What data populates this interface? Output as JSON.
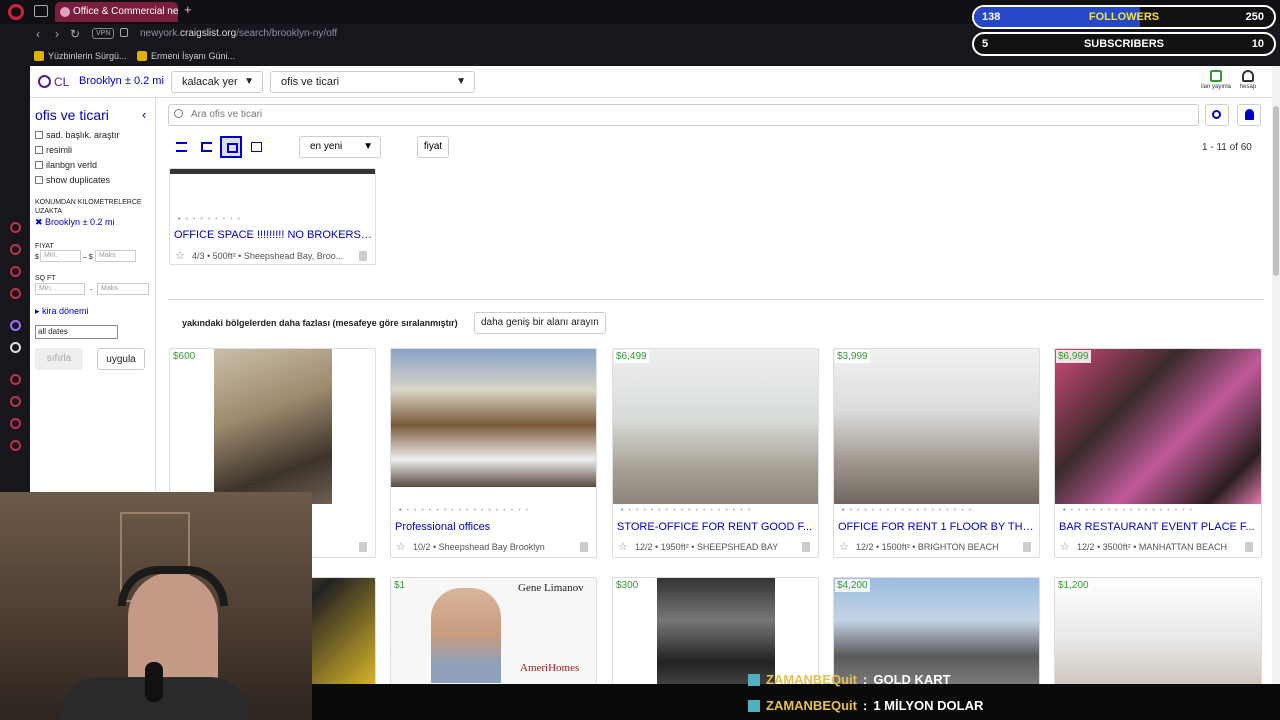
{
  "browser": {
    "tab_title": "Office & Commercial near",
    "url_prefix": "newyork.",
    "url_host": "craigslist.org",
    "url_path": "/search/brooklyn-ny/off",
    "vpn_label": "VPN",
    "bookmarks": [
      "Yüzbinlerin Sürgü...",
      "Ermeni İsyanı Güni..."
    ]
  },
  "header": {
    "logo": "CL",
    "location": "Brooklyn ± 0.2 mi",
    "area_select": "kalacak yer",
    "category_select": "ofis ve ticari",
    "post_label": "ilan yayınla",
    "account_label": "hesap"
  },
  "filters": {
    "title": "ofis ve ticari",
    "checkboxes": [
      "sad. başlık. araştır",
      "resimli",
      "ilanbgn verld",
      "show duplicates"
    ],
    "distance_label": "KONUMDAN KILOMETRELERCE UZAKTA",
    "distance_value": "Brooklyn ± 0.2 mi",
    "price_label": "FIYAT",
    "price_currency": "$",
    "price_dash": "– $",
    "price_min": "Min.",
    "price_max": "Maks",
    "sqft_label": "SQ FT",
    "sqft_min": "Min.",
    "sqft_dash": "-",
    "sqft_max": "Maks",
    "rent_period": "kira dönemi",
    "dates": "all dates",
    "reset": "sıfırla",
    "apply": "uygula"
  },
  "search": {
    "placeholder": "Ara ofis ve ticari"
  },
  "toolbar": {
    "sort": "en yeni",
    "price": "fiyat",
    "count": "1 - 11 of 60"
  },
  "listings": [
    {
      "title": "OFFICE SPACE !!!!!!!!! NO BROKERS F...",
      "meta": "4/3 • 500ft² • Sheepshead Bay, Broo..."
    }
  ],
  "nearby": {
    "label": "yakındaki bölgelerden daha fazlası (mesafeye göre sıralanmıştır)",
    "widen": "daha geniş bir alanı arayın",
    "cards": [
      {
        "price": "$600",
        "title": "",
        "meta": ""
      },
      {
        "price": "",
        "title": "Professional offices",
        "meta": "10/2 • Sheepshead Bay Brooklyn"
      },
      {
        "price": "$6,499",
        "title": "STORE-OFFICE FOR RENT GOOD F...",
        "meta": "12/2 • 1950ft² • SHEEPSHEAD BAY"
      },
      {
        "price": "$3,999",
        "title": "OFFICE FOR RENT 1 FLOOR BY THE...",
        "meta": "12/2 • 1500ft² • BRIGHTON BEACH"
      },
      {
        "price": "$6,999",
        "title": "BAR RESTAURANT EVENT PLACE F...",
        "meta": "12/2 • 3500ft² • MANHATTAN BEACH"
      }
    ],
    "row2_prices": [
      "$1",
      "$300",
      "$4,200",
      "$1,200"
    ],
    "row2_ad_name": "Gene Limanov",
    "row2_ad_brand": "AmeriHomes"
  },
  "stream": {
    "followers": {
      "current": "138",
      "label": "FOLLOWERS",
      "goal": "250"
    },
    "subscribers": {
      "current": "5",
      "label": "SUBSCRIBERS",
      "goal": "10"
    },
    "chat": [
      {
        "user": "ZAMANBEQuit",
        "sep": ":",
        "message": "GOLD KART"
      },
      {
        "user": "ZAMANBEQuit",
        "sep": ":",
        "message": "1 MİLYON DOLAR"
      }
    ]
  },
  "colors": {
    "link": "#0000cc",
    "price": "#339933",
    "tab_active": "#7a1e3b",
    "follower_bar": "#2747c9"
  }
}
